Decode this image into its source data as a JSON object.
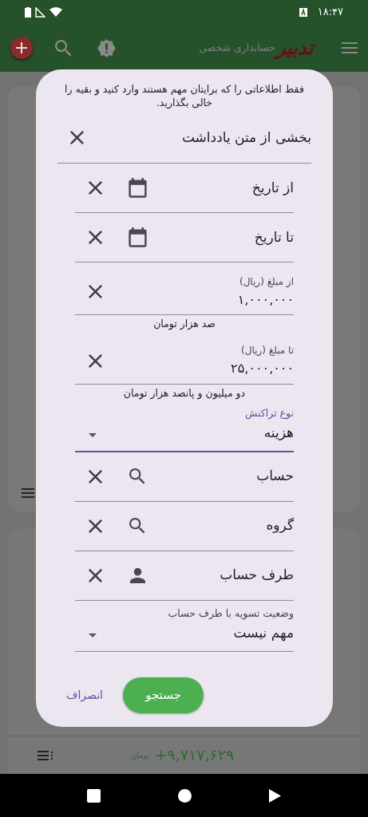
{
  "status_bar": {
    "time": "۱۸:۴۷"
  },
  "toolbar": {
    "logo": "تدبیر",
    "subtitle": "حسابداری شخصی"
  },
  "background": {
    "total": "+۹,۷۱۷,۶۲۹",
    "currency": "تومان"
  },
  "dialog": {
    "hint": "فقط اطلاعاتی را که برایتان مهم هستند وارد کنید و بقیه را خالی بگذارید.",
    "fields": [
      {
        "kind": "text",
        "label": "بخشی از متن یادداشت",
        "focused": false
      },
      {
        "kind": "date",
        "label": "از تاریخ",
        "focused": false
      },
      {
        "kind": "date",
        "label": "تا تاریخ",
        "focused": false
      },
      {
        "kind": "amount",
        "label": "از مبلغ (ریال)",
        "value": "۱,۰۰۰,۰۰۰",
        "helper": "صد هزار تومان",
        "focused": false
      },
      {
        "kind": "amount",
        "label": "تا مبلغ (ریال)",
        "value": "۲۵,۰۰۰,۰۰۰",
        "helper": "دو میلیون و پانصد هزار تومان",
        "focused": false
      },
      {
        "kind": "select",
        "label": "نوع تراکنش",
        "value": "هزینه",
        "focused": true
      },
      {
        "kind": "search",
        "label": "حساب",
        "focused": false
      },
      {
        "kind": "search",
        "label": "گروه",
        "focused": false
      },
      {
        "kind": "person",
        "label": "طرف حساب",
        "focused": false
      },
      {
        "kind": "select",
        "label": "وضعیت تسویه با طرف حساب",
        "value": "مهم نیست",
        "focused": false
      }
    ],
    "buttons": {
      "submit": "جستجو",
      "cancel": "انصراف"
    }
  }
}
